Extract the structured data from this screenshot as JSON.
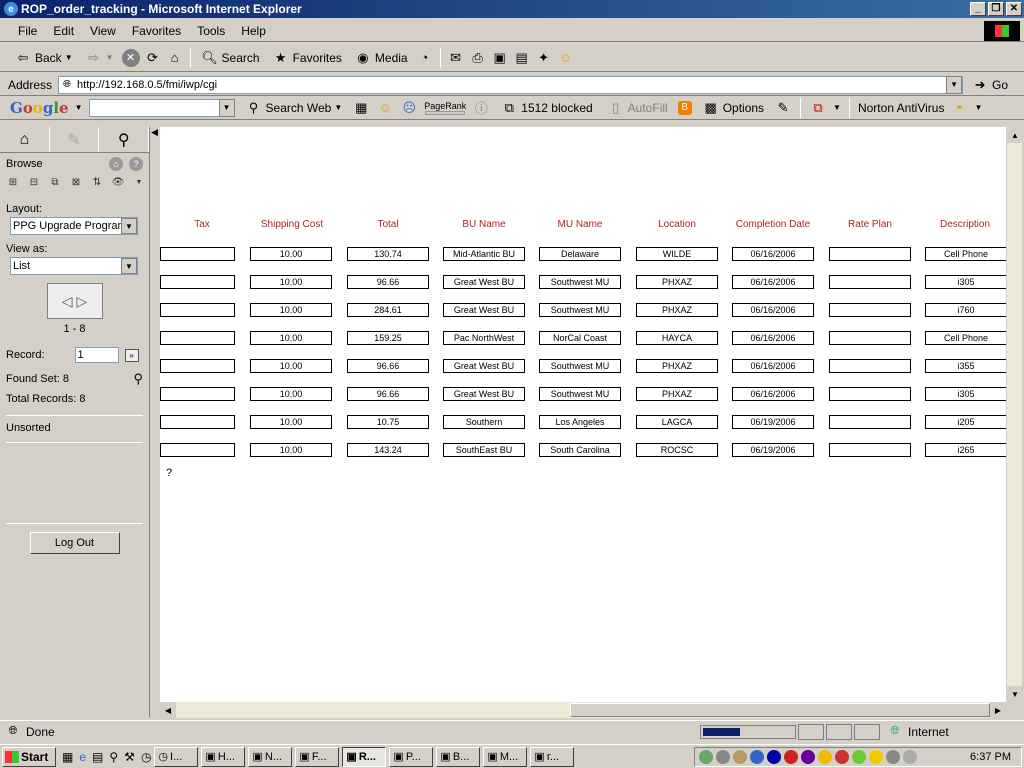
{
  "window": {
    "title": "ROP_order_tracking - Microsoft Internet Explorer"
  },
  "menu": [
    "File",
    "Edit",
    "View",
    "Favorites",
    "Tools",
    "Help"
  ],
  "toolbar": {
    "back": "Back",
    "search": "Search",
    "favorites": "Favorites",
    "media": "Media"
  },
  "address": {
    "label": "Address",
    "url": "http://192.168.0.5/fmi/iwp/cgi",
    "go": "Go"
  },
  "googlebar": {
    "logo": [
      "G",
      "o",
      "o",
      "g",
      "l",
      "e"
    ],
    "search_web": "Search Web",
    "pagerank": "PageRank",
    "blocked": "1512 blocked",
    "autofill": "AutoFill",
    "options": "Options",
    "norton": "Norton AntiVirus"
  },
  "sidebar": {
    "browse": "Browse",
    "layout_label": "Layout:",
    "layout_value": "PPG Upgrade Program",
    "view_label": "View as:",
    "view_value": "List",
    "range": "1 - 8",
    "record_label": "Record:",
    "record_value": "1",
    "found_set": "Found Set: 8",
    "total_records": "Total Records: 8",
    "sort": "Unsorted",
    "logout": "Log Out"
  },
  "table": {
    "headers": [
      "Tax",
      "Shipping Cost",
      "Total",
      "BU Name",
      "MU Name",
      "Location",
      "Completion Date",
      "Rate Plan",
      "Description"
    ],
    "rows": [
      [
        "",
        "10.00",
        "130.74",
        "Mid-Atlantic BU",
        "Delaware",
        "WILDE",
        "06/16/2006",
        "",
        "Cell Phone"
      ],
      [
        "",
        "10.00",
        "96.66",
        "Great West BU",
        "Southwest MU",
        "PHXAZ",
        "06/16/2006",
        "",
        "i305"
      ],
      [
        "",
        "10.00",
        "284.61",
        "Great West BU",
        "Southwest MU",
        "PHXAZ",
        "06/16/2006",
        "",
        "i760"
      ],
      [
        "",
        "10.00",
        "159.25",
        "Pac NorthWest",
        "NorCal Coast",
        "HAYCA",
        "06/16/2006",
        "",
        "Cell Phone"
      ],
      [
        "",
        "10.00",
        "96.66",
        "Great West BU",
        "Southwest MU",
        "PHXAZ",
        "06/16/2006",
        "",
        "i355"
      ],
      [
        "",
        "10.00",
        "96.66",
        "Great West BU",
        "Southwest MU",
        "PHXAZ",
        "06/16/2006",
        "",
        "i305"
      ],
      [
        "",
        "10.00",
        "10.75",
        "Southern",
        "Los Angeles",
        "LAGCA",
        "06/19/2006",
        "",
        "i205"
      ],
      [
        "",
        "10.00",
        "143.24",
        "SouthEast BU",
        "South Carolina",
        "ROCSC",
        "06/19/2006",
        "",
        "i265"
      ]
    ],
    "footer_mark": "?"
  },
  "status": {
    "text": "Done",
    "zone": "Internet",
    "progress": 0.4
  },
  "taskbar": {
    "start": "Start",
    "tasks": [
      "I...",
      "H...",
      "N...",
      "F...",
      "R...",
      "P...",
      "B...",
      "M...",
      "r..."
    ],
    "active_index": 4,
    "clock": "6:37 PM"
  }
}
